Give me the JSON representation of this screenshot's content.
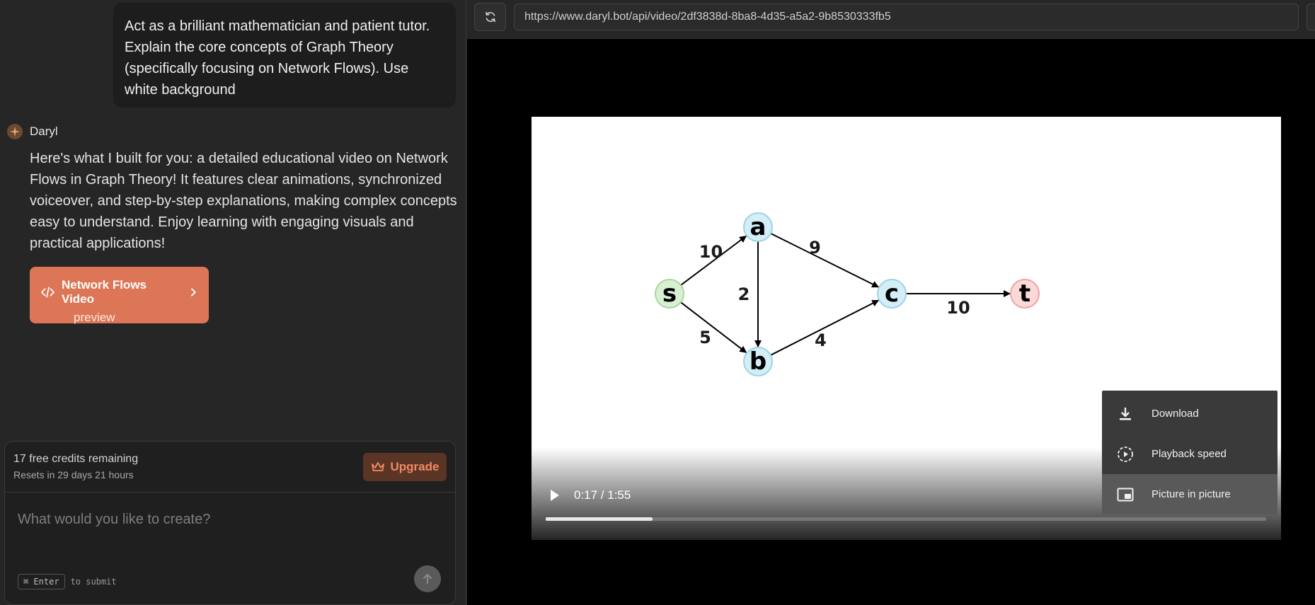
{
  "chat": {
    "user_message": "Act as a brilliant mathematician and patient tutor. Explain the core concepts of Graph Theory (specifically focusing on Network Flows). Use white background",
    "assistant_name": "Daryl",
    "assistant_message": "Here's what I built for you: a detailed educational video on Network Flows in Graph Theory! It features clear animations, synchronized voiceover, and step-by-step explanations, making complex concepts easy to understand. Enjoy learning with engaging visuals and practical applications!",
    "artifact": {
      "title": "Network Flows Video",
      "subtitle": "preview"
    }
  },
  "composer": {
    "credits_text": "17 free credits remaining",
    "resets_text": "Resets in 29 days 21 hours",
    "upgrade_label": "Upgrade",
    "placeholder": "What would you like to create?",
    "shortcut_key": "⌘ Enter",
    "shortcut_hint": "to submit"
  },
  "browser": {
    "url": "https://www.daryl.bot/api/video/2df3838d-8ba8-4d35-a5a2-9b8530333fb5"
  },
  "video": {
    "time_display": "0:17 / 1:55",
    "progress_fraction": 0.148,
    "graph": {
      "nodes": [
        "s",
        "a",
        "b",
        "c",
        "t"
      ],
      "edges": [
        {
          "from": "s",
          "to": "a",
          "capacity": "10"
        },
        {
          "from": "s",
          "to": "b",
          "capacity": "5"
        },
        {
          "from": "a",
          "to": "b",
          "capacity": "2"
        },
        {
          "from": "a",
          "to": "c",
          "capacity": "9"
        },
        {
          "from": "b",
          "to": "c",
          "capacity": "4"
        },
        {
          "from": "c",
          "to": "t",
          "capacity": "10"
        }
      ]
    },
    "menu": {
      "items": [
        {
          "label": "Download",
          "icon": "download-icon"
        },
        {
          "label": "Playback speed",
          "icon": "playback-speed-icon"
        },
        {
          "label": "Picture in picture",
          "icon": "picture-in-picture-icon"
        }
      ],
      "highlighted_index": 2
    }
  },
  "colors": {
    "accent": "#dd7656",
    "node_source": "#d8f0d2",
    "node_inner": "#d4eef7",
    "node_sink": "#fbd9d9"
  }
}
